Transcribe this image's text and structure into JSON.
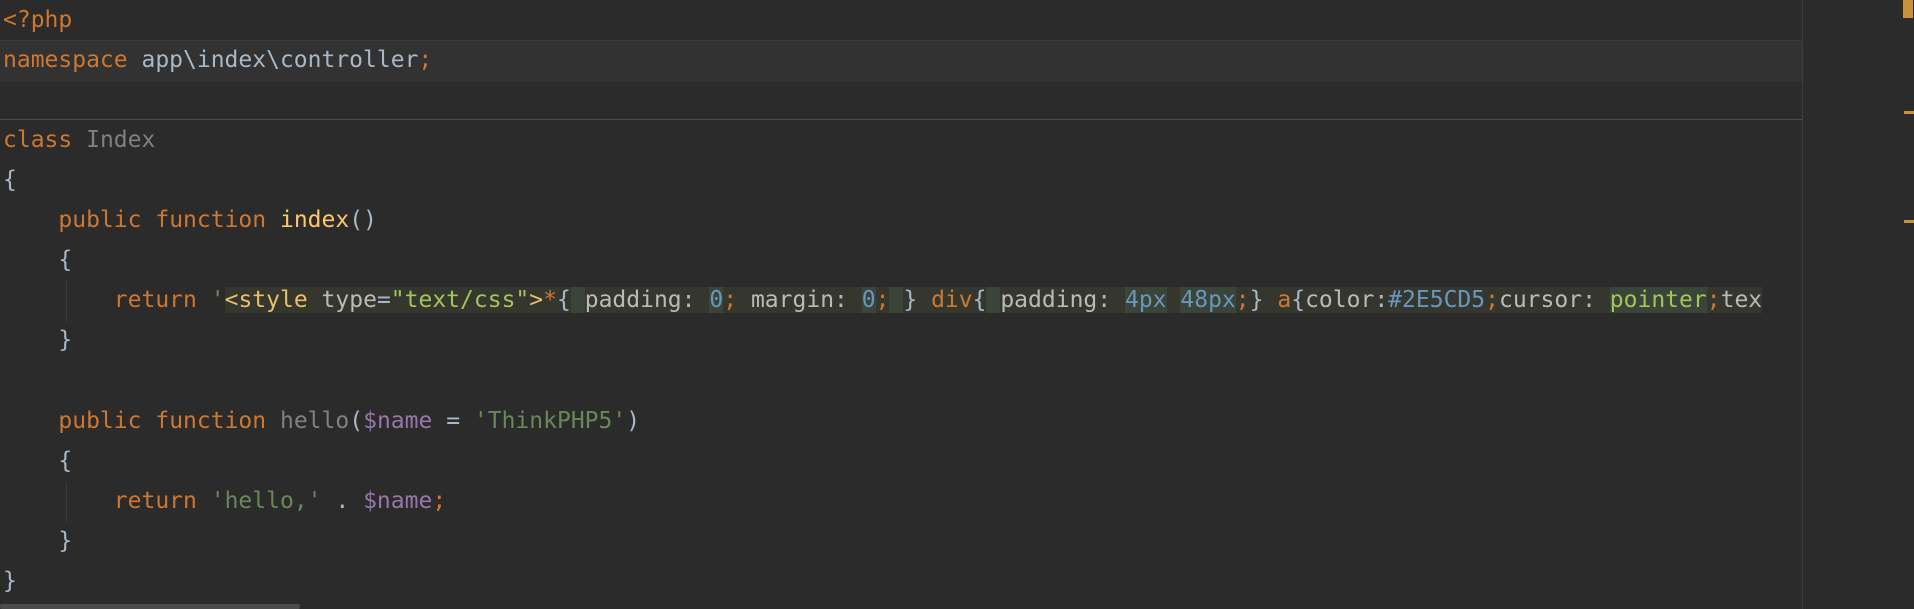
{
  "editor": {
    "language": "php",
    "lines": {
      "l1": {
        "open_tag": "<?php"
      },
      "l2": {
        "kw": "namespace",
        "name": " app\\index\\controller",
        "semi": ";"
      },
      "l4": {
        "kw": "class",
        "name": "Index"
      },
      "l5": {
        "brace": "{"
      },
      "l6": {
        "kw_public": "public",
        "kw_function": "function",
        "fn_name": "index",
        "parens": "()"
      },
      "l7": {
        "brace": "{"
      },
      "l8": {
        "kw_return": "return",
        "quote": "'",
        "tag_open": "<style",
        "attr_name": "type",
        "attr_eq": "=",
        "attr_value": "\"text/css\"",
        "tag_close": ">",
        "sel_star": "*",
        "brace1": "{",
        "prop_padding1": "padding",
        "colon1": ":",
        "val_zero1": "0",
        "semi1": ";",
        "prop_margin": "margin",
        "colon2": ":",
        "val_zero2": "0",
        "semi2": ";",
        "brace1_close": "}",
        "sel_div": "div",
        "brace2": "{",
        "prop_padding2": "padding",
        "colon3": ":",
        "val_4px": "4px",
        "val_48px": "48px",
        "semi3": ";",
        "brace2_close": "}",
        "sel_a": "a",
        "brace3": "{",
        "prop_color": "color",
        "colon4": ":",
        "val_color": "#2E5CD5",
        "semi4": ";",
        "prop_cursor": "cursor",
        "colon5": ":",
        "val_pointer": "pointer",
        "semi5": ";",
        "prop_tex": "tex"
      },
      "l9": {
        "brace": "}"
      },
      "l11": {
        "kw_public": "public",
        "kw_function": "function",
        "fn_name": "hello",
        "paren_open": "(",
        "param": "$name",
        "eq": " = ",
        "default": "'ThinkPHP5'",
        "paren_close": ")"
      },
      "l12": {
        "brace": "{"
      },
      "l13": {
        "kw_return": "return",
        "str": "'hello,'",
        "dot": " . ",
        "var": "$name",
        "semi": ";"
      },
      "l14": {
        "brace": "}"
      },
      "l15": {
        "brace": "}"
      }
    }
  },
  "colors": {
    "background": "#2b2b2b",
    "keyword": "#cc7832",
    "function": "#ffc66d",
    "string": "#6a8759",
    "variable": "#9876aa",
    "number": "#6897bb",
    "marker": "#c9913e"
  }
}
